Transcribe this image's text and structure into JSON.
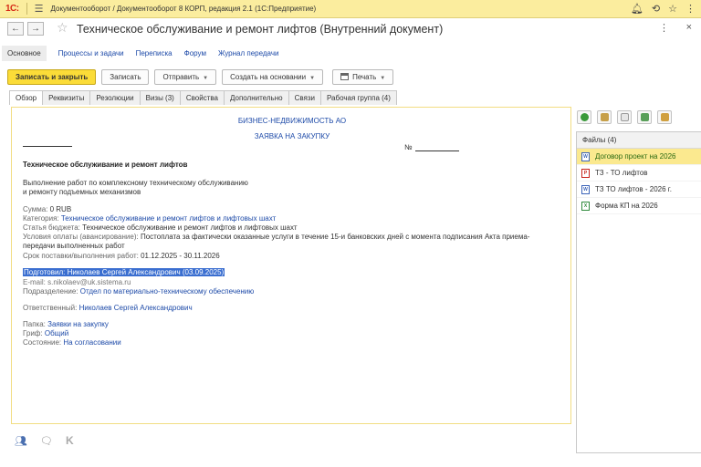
{
  "window": {
    "app_title": "Документооборот / Документооборот 8 КОРП, редакция 2.1  (1С:Предприятие)",
    "logo": "1С:"
  },
  "header": {
    "title": "Техническое обслуживание и ремонт лифтов (Внутренний документ)",
    "more_label": "⋮",
    "close_label": "×"
  },
  "nav": {
    "items": [
      {
        "label": "Основное"
      },
      {
        "label": "Процессы и задачи"
      },
      {
        "label": "Переписка"
      },
      {
        "label": "Форум"
      },
      {
        "label": "Журнал передачи"
      }
    ]
  },
  "toolbar": {
    "save_close": "Записать и закрыть",
    "save": "Записать",
    "send": "Отправить",
    "create_based": "Создать на основании",
    "print": "Печать"
  },
  "tabs": [
    {
      "label": "Обзор"
    },
    {
      "label": "Реквизиты"
    },
    {
      "label": "Резолюции"
    },
    {
      "label": "Визы (3)"
    },
    {
      "label": "Свойства"
    },
    {
      "label": "Дополнительно"
    },
    {
      "label": "Связи"
    },
    {
      "label": "Рабочая группа (4)"
    }
  ],
  "doc": {
    "org": "БИЗНЕС-НЕДВИЖИМОСТЬ АО",
    "type": "ЗАЯВКА НА ЗАКУПКУ",
    "number_label": "№",
    "heading": "Техническое обслуживание и ремонт лифтов",
    "desc_line1": "Выполнение работ по комплексному техническому обслуживанию",
    "desc_line2": "и ремонту подъемных механизмов",
    "sum_label": "Сумма:",
    "sum_value": "0 RUB",
    "category_label": "Категория:",
    "category_value": "Техническое обслуживание и ремонт лифтов и лифтовых шахт",
    "budget_label": "Статья бюджета:",
    "budget_value": "Техническое обслуживание и ремонт лифтов и лифтовых шахт",
    "payment_label": "Условия оплаты (авансирование):",
    "payment_value": "Постоплата за фактически оказанные услуги в течение 15-и банковских дней с момента подписания Акта приема-",
    "payment_value2": "передачи выполненных работ",
    "term_label": "Срок поставки/выполнения работ:",
    "term_value": "01.12.2025 - 30.11.2026",
    "prepared_label": "Подготовил:",
    "prepared_value": "Николаев Сергей Александрович (03.09.2025)",
    "email_label": "E-mail:",
    "email_value": "s.nikolaev@uk.sistema.ru",
    "dept_label": "Подразделение:",
    "dept_value": "Отдел по материально-техническому обеспечению",
    "resp_label": "Ответственный:",
    "resp_value": "Николаев Сергей Александрович",
    "folder_label": "Папка:",
    "folder_value": "Заявки на закупку",
    "grif_label": "Гриф:",
    "grif_value": "Общий",
    "state_label": "Состояние:",
    "state_value": "На согласовании"
  },
  "files": {
    "header": "Файлы (4)",
    "items": [
      {
        "name": "Договор проект на 2026",
        "type": "doc"
      },
      {
        "name": "ТЗ - ТО лифтов",
        "type": "pdf"
      },
      {
        "name": "ТЗ ТО лифтов - 2026 г.",
        "type": "doc"
      },
      {
        "name": "Форма КП на 2026",
        "type": "xls"
      }
    ]
  },
  "bottom": {
    "k_label": "K"
  },
  "colors": {
    "title_bar": "#fbed9e",
    "primary_button": "#fbdc38",
    "link": "#1d4aa8",
    "selected_file_row": "#fbe98f"
  }
}
